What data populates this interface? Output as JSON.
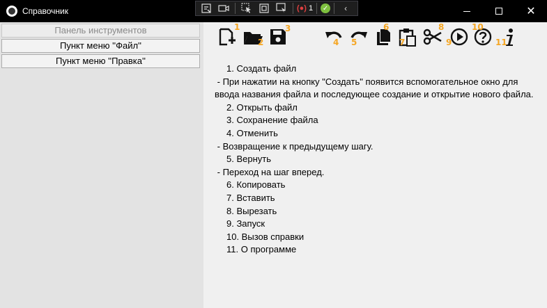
{
  "window": {
    "title": "Справочник",
    "controls": {
      "minimize": "minimize",
      "maximize": "maximize",
      "close": "✕"
    }
  },
  "debug_toolbar": {
    "record_label": "(●)",
    "count": "1",
    "check": "✓",
    "chevron": "‹"
  },
  "sidebar": {
    "items": [
      {
        "label": "Панель инструментов",
        "enabled": false
      },
      {
        "label": "Пункт меню ''Файл''",
        "enabled": true
      },
      {
        "label": "Пункт меню ''Правка''",
        "enabled": true
      }
    ]
  },
  "toolbar_icons": [
    {
      "name": "new-file-icon",
      "number": "1"
    },
    {
      "name": "open-folder-icon",
      "number": "2"
    },
    {
      "name": "save-icon",
      "number": "3"
    },
    {
      "name": "undo-icon",
      "number": "4"
    },
    {
      "name": "redo-icon",
      "number": "5"
    },
    {
      "name": "copy-icon",
      "number": "6"
    },
    {
      "name": "paste-icon",
      "number": "7"
    },
    {
      "name": "cut-icon",
      "number": "8"
    },
    {
      "name": "run-icon",
      "number": "9"
    },
    {
      "name": "help-icon",
      "number": "10"
    },
    {
      "name": "info-icon",
      "number": "11"
    }
  ],
  "help": {
    "lines": [
      "1. Создать файл",
      " - При нажатии на кнопку \"Создать\" появится вспомогательное окно для ввода названия файла и последующее создание и открытие нового файла.",
      "2. Открыть файл",
      "3. Сохранение файла",
      "4. Отменить",
      " - Возвращение к предыдущему шагу.",
      "5. Вернуть",
      " - Переход на шаг вперед.",
      "6. Копировать",
      "7. Вставить",
      "8. Вырезать",
      "9. Запуск",
      "10. Вызов справки",
      "11. О программе"
    ]
  },
  "colors": {
    "titlebar_bg": "#000000",
    "panel_bg": "#e3e3e3",
    "content_bg": "#f0f0f0",
    "number_accent": "#f5a623"
  }
}
